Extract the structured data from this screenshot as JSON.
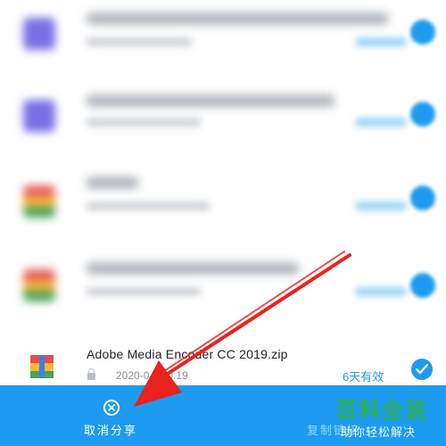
{
  "file_list": {
    "selected_item": {
      "icon": "zip-archive-icon",
      "name": "Adobe Media Encoder CC 2019.zip",
      "date": "2020-0   4 20:19",
      "validity": "6天有效",
      "checked": true
    }
  },
  "bottom_bar": {
    "cancel_label": "取消分享",
    "cancel_icon": "close-circle-icon",
    "copy_label": "复制链接"
  },
  "watermark": {
    "title": "百科全说",
    "subtitle": "助你轻松解决"
  },
  "colors": {
    "accent": "#1d9bf0",
    "arrow": "#e8231e",
    "watermark": "#2bb34a"
  }
}
